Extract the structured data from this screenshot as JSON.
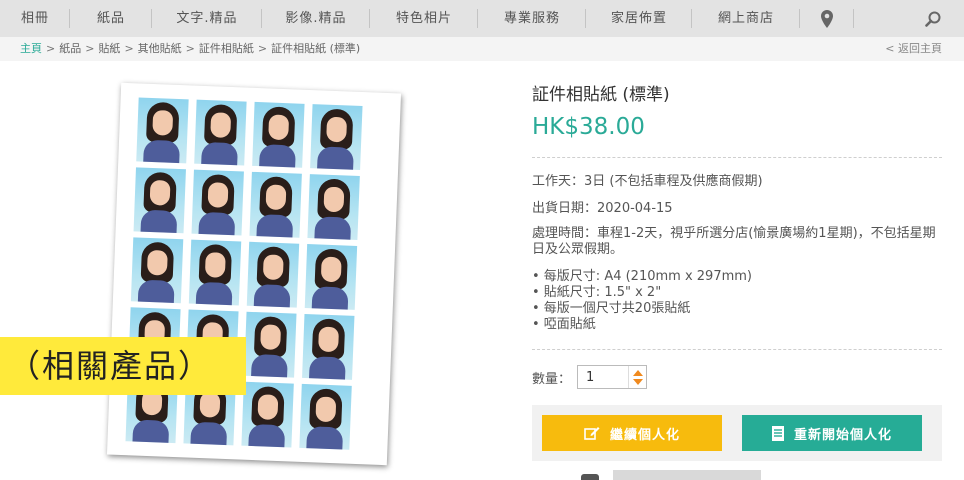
{
  "nav": {
    "items": [
      "相冊",
      "紙品",
      "文字.精品",
      "影像.精品",
      "特色相片",
      "專業服務",
      "家居佈置",
      "網上商店"
    ],
    "map_icon": "map-pin-icon",
    "search_icon": "search-icon"
  },
  "breadcrumb": {
    "items": [
      "主頁",
      "紙品",
      "貼紙",
      "其他貼紙",
      "証件相貼紙",
      "証件相貼紙 (標準)"
    ],
    "separator": ">",
    "back": "< 返回主頁"
  },
  "related_badge": "（相關產品）",
  "product": {
    "title": "証件相貼紙 (標準)",
    "price": "HK$38.00",
    "working_days": "工作天：3日 (不包括車程及供應商假期)",
    "ship_date": "出貨日期：2020-04-15",
    "processing": "處理時間：車程1-2天，視乎所選分店(愉景廣場約1星期)，不包括星期日及公眾假期。",
    "specs": [
      "• 每版尺寸: A4 (210mm x 297mm)",
      "• 貼紙尺寸: 1.5\" x 2\"",
      "• 每版一個尺寸共20張貼紙",
      "• 啞面貼紙"
    ]
  },
  "quantity": {
    "label": "數量：",
    "value": "1"
  },
  "buttons": {
    "continue": "繼續個人化",
    "continue_icon": "edit-icon",
    "restart": "重新開始個人化",
    "restart_icon": "document-icon"
  },
  "colors": {
    "accent_teal": "#2aaa97",
    "button_yellow": "#f7bb0d",
    "button_teal": "#26ac96",
    "badge_yellow": "#ffea3b"
  }
}
